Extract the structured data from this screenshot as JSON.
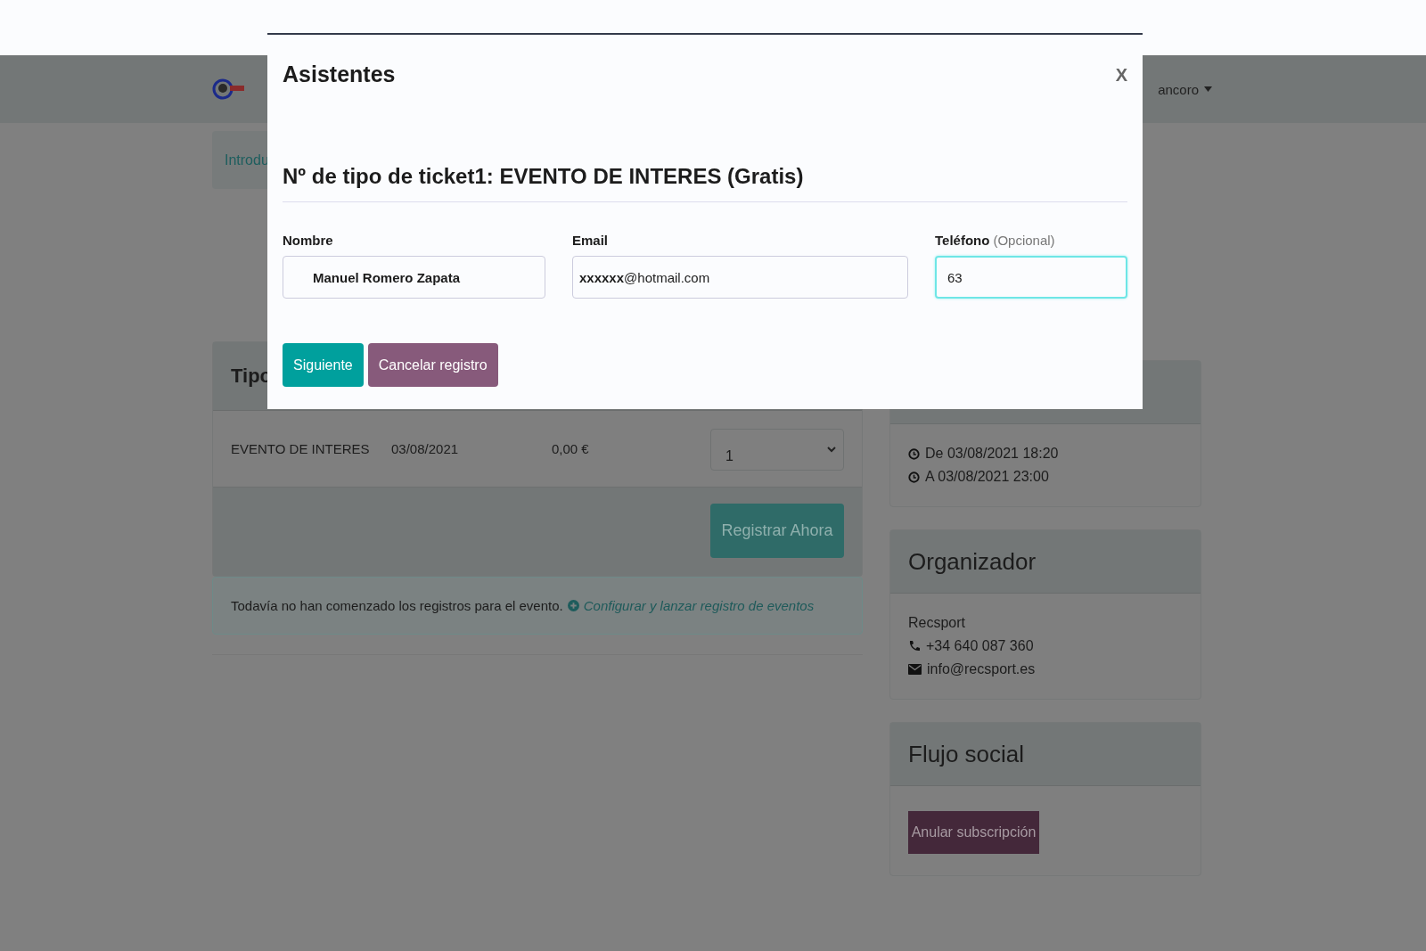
{
  "navbar": {
    "user_menu": "ancoro"
  },
  "breadcrumb": {
    "label": "Introdu"
  },
  "tickets_card": {
    "title": "Tipo",
    "rows": [
      {
        "name": "EVENTO DE INTERES",
        "date": "03/08/2021",
        "price": "0,00 €",
        "quantity": "1"
      }
    ],
    "register_button": "Registrar Ahora"
  },
  "notice": {
    "text": "Todavía no han comenzado los registros para el evento.",
    "link": "Configurar y lanzar registro de eventos"
  },
  "sidebar": {
    "dates": [
      "De 03/08/2021 18:20",
      "A 03/08/2021 23:00"
    ],
    "organizer": {
      "title": "Organizador",
      "name": "Recsport",
      "phone": "+34 640 087 360",
      "email": "info@recsport.es"
    },
    "social": {
      "title": "Flujo social",
      "button": "Anular subscripción"
    }
  },
  "modal": {
    "title": "Asistentes",
    "close": "X",
    "section_title": "Nº de tipo de ticket1: EVENTO DE INTERES (Gratis)",
    "fields": [
      {
        "label": "Nombre",
        "value": "Manuel Romero Zapata",
        "focused": false
      },
      {
        "label": "Email",
        "value": "**xxxxxx**@hotmail.com",
        "focused": false
      },
      {
        "label": "Teléfono",
        "note": "(Opcional)",
        "value": "63",
        "focused": true
      }
    ],
    "buttons": [
      {
        "label": "Siguiente",
        "kind": "primary"
      },
      {
        "label": "Cancelar registro",
        "kind": "secondary"
      }
    ]
  }
}
